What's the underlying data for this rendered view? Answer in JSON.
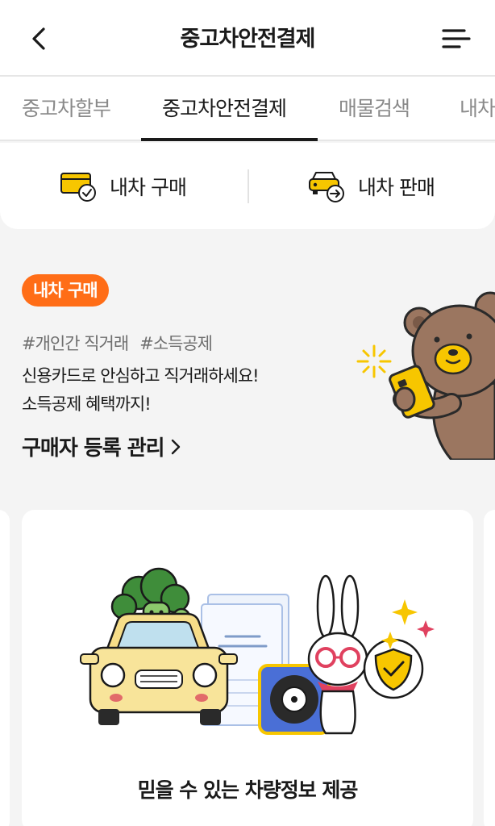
{
  "header": {
    "title": "중고차안전결제"
  },
  "tabs": [
    {
      "label": "중고차할부",
      "active": false
    },
    {
      "label": "중고차안전결제",
      "active": true
    },
    {
      "label": "매물검색",
      "active": false
    },
    {
      "label": "내차",
      "active": false
    }
  ],
  "quick_actions": [
    {
      "label": "내차 구매",
      "icon": "card-check-icon"
    },
    {
      "label": "내차 판매",
      "icon": "car-transfer-icon"
    }
  ],
  "promo": {
    "badge": "내차 구매",
    "tags": [
      "#개인간 직거래",
      "#소득공제"
    ],
    "desc_line1": "신용카드로 안심하고 직거래하세요!",
    "desc_line2": "소득공제 혜택까지!",
    "link": "구매자 등록 관리"
  },
  "card": {
    "caption": "믿을 수 있는 차량정보 제공"
  },
  "colors": {
    "accent": "#ff6d17",
    "brand_yellow": "#f7c600",
    "text": "#1a1a1a",
    "muted": "#8a8a8a"
  }
}
